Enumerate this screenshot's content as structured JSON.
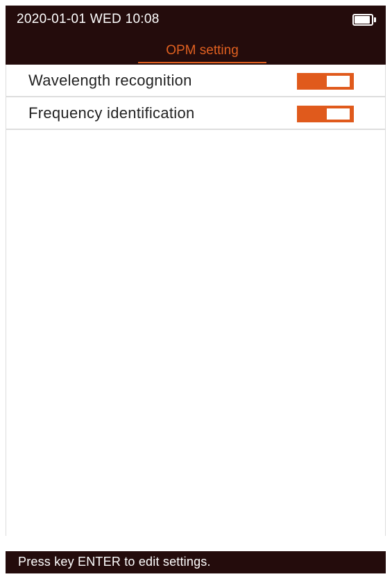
{
  "status_bar": {
    "date_time": "2020-01-01  WED  10:08",
    "battery_icon": "battery-full-icon"
  },
  "header": {
    "tab_title": "OPM setting"
  },
  "settings": [
    {
      "label": "Wavelength recognition",
      "enabled": true
    },
    {
      "label": "Frequency identification",
      "enabled": true
    }
  ],
  "footer": {
    "hint": "Press key ENTER to edit settings."
  },
  "colors": {
    "header_bg": "#240c0c",
    "accent": "#e05a1c",
    "text": "#222222"
  }
}
